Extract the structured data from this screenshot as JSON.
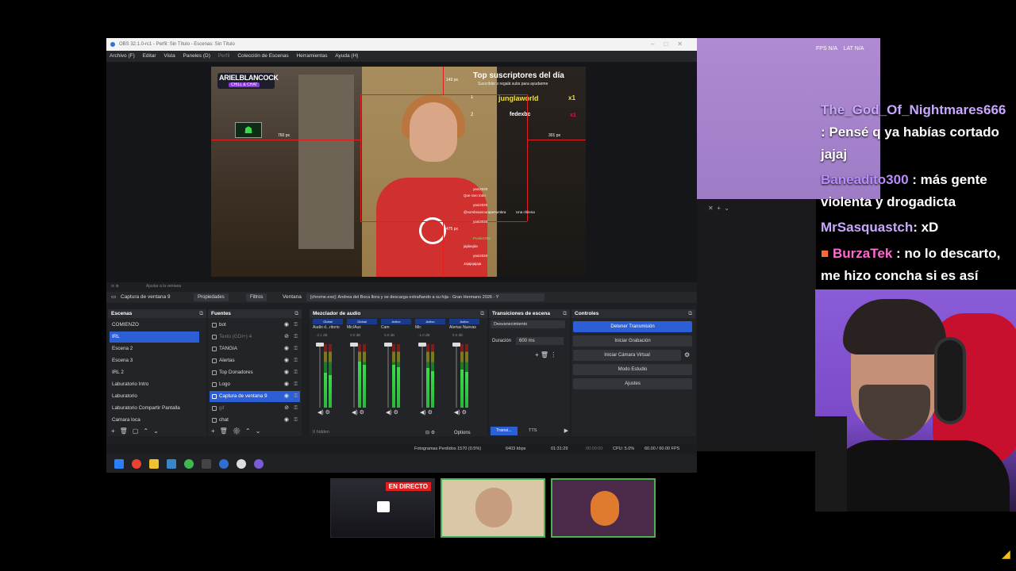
{
  "obs": {
    "title": "OBS 32.1.0-rc1 - Perfil: Sin Título - Escenas: Sin Título",
    "menu": [
      "Archivo (F)",
      "Editar",
      "Vista",
      "Paneles (D)",
      "Perfil",
      "Colección de Escenas",
      "Herramientas",
      "Ayuda (H)"
    ],
    "overlay": {
      "brand_name": "ARIELBLANCOCK",
      "brand_sub": "CHILL & CHAT",
      "top_title": "Top suscriptores del día",
      "top_subtitle": "Suscribite o regalá subs para ayudarme",
      "subs": [
        {
          "rank": "1",
          "name": "junglaworld",
          "count": "x1"
        },
        {
          "rank": "2",
          "name": "fedexbc",
          "count": "x1"
        }
      ],
      "guides": {
        "top": "149 px",
        "left": "760 px",
        "right": "301 px",
        "bottom": "475 px"
      },
      "chat": [
        {
          "user": "yani2020",
          "text": "Que raro todo"
        },
        {
          "user": "yani2020",
          "text": ""
        },
        {
          "user": "@sombraoscurapenumbra",
          "text": "Una chilena"
        },
        {
          "user": "yani2020",
          "text": ""
        },
        {
          "user": "Punker289",
          "text": ""
        },
        {
          "user": "",
          "text": "jajdasjda"
        },
        {
          "user": "yani2020",
          "text": ""
        },
        {
          "user": "",
          "text": "Jajajajajaja"
        }
      ]
    },
    "preview_toolbar": "Ajustar a la ventana",
    "source_toolbar": {
      "selected": "Captura de ventana 9",
      "properties": "Propiedades",
      "filters": "Filtros",
      "window_label": "Ventana",
      "window_value": "[chrome.exe]: Andrea del Boca llora y se descarga extrañando a su hija - Gran Hermano 2026 - Y"
    },
    "scenes": {
      "title": "Escenas",
      "items": [
        "COMIENZO",
        "IRL",
        "Escena 2",
        "Escena 3",
        "IRL 2",
        "Laburatorio Intro",
        "Laburatorio",
        "Laburatorio Compartir Pantalla",
        "Camara loca"
      ],
      "selected_index": 1
    },
    "sources": {
      "title": "Fuentes",
      "items": [
        "bot",
        "Texto (GDI+) 4",
        "TANGIA",
        "Alertas",
        "Top Donadores",
        "Logo",
        "Captura de ventana 9",
        "gif",
        "chat"
      ],
      "selected_index": 6,
      "dim_indices": [
        1,
        7
      ]
    },
    "mixer": {
      "title": "Mezclador de audio",
      "channels": [
        {
          "tag": "Global",
          "name": "Audio d...ritorio",
          "db": "-2.1 dB",
          "level": 0.55
        },
        {
          "tag": "Global",
          "name": "Mic/Aux",
          "db": "0.0 dB",
          "level": 0.72
        },
        {
          "tag": "Activo",
          "name": "Cam",
          "db": "0.0 dB",
          "level": 0.68
        },
        {
          "tag": "Activo",
          "name": "Mic",
          "db": "-1.0 dB",
          "level": 0.62
        },
        {
          "tag": "Activo",
          "name": "Alertas Nuevas",
          "db": "0.0 dB",
          "level": 0.6
        }
      ],
      "hidden": "0 hidden",
      "options": "Options"
    },
    "transitions": {
      "title": "Transiciones de escena",
      "selected": "Desvanecimiento",
      "duration_label": "Duración",
      "duration_value": "600 ms",
      "tabs": [
        "Transi...",
        "TTS"
      ]
    },
    "controls": {
      "title": "Controles",
      "buttons": [
        "Detener Transmisión",
        "Iniciar Grabación",
        "Iniciar Cámara Virtual",
        "Modo Estudio",
        "Ajustes"
      ]
    },
    "status": {
      "dropped": "Fotogramas Perdidos 1570 (0.5%)",
      "bitrate": "6403 kbps",
      "stream_time": "01:31:29",
      "rec_time": "00:00:00",
      "cpu": "CPU: 5.0%",
      "fps": "60.00 / 60.00 FPS"
    }
  },
  "right": {
    "fps": "FPS N/A",
    "lat": "LAT N/A",
    "messages": [
      {
        "user": "The_God_Of_Nightmares666",
        "text": ": Pensé q ya habías cortado jajaj"
      },
      {
        "user": "Baneadito300",
        "text": ": más gente violenta y drogadicta"
      },
      {
        "user": "MrSasquastch",
        "text": ": xD"
      },
      {
        "user": "BurzaTek",
        "text": ": no lo descarto, me hizo concha si es así"
      }
    ]
  },
  "thumbnails": {
    "live_badge": "EN DIRECTO"
  },
  "colors": {
    "accent": "#2c5fd6",
    "live": "#e02020",
    "highlight": "#4caf50"
  }
}
